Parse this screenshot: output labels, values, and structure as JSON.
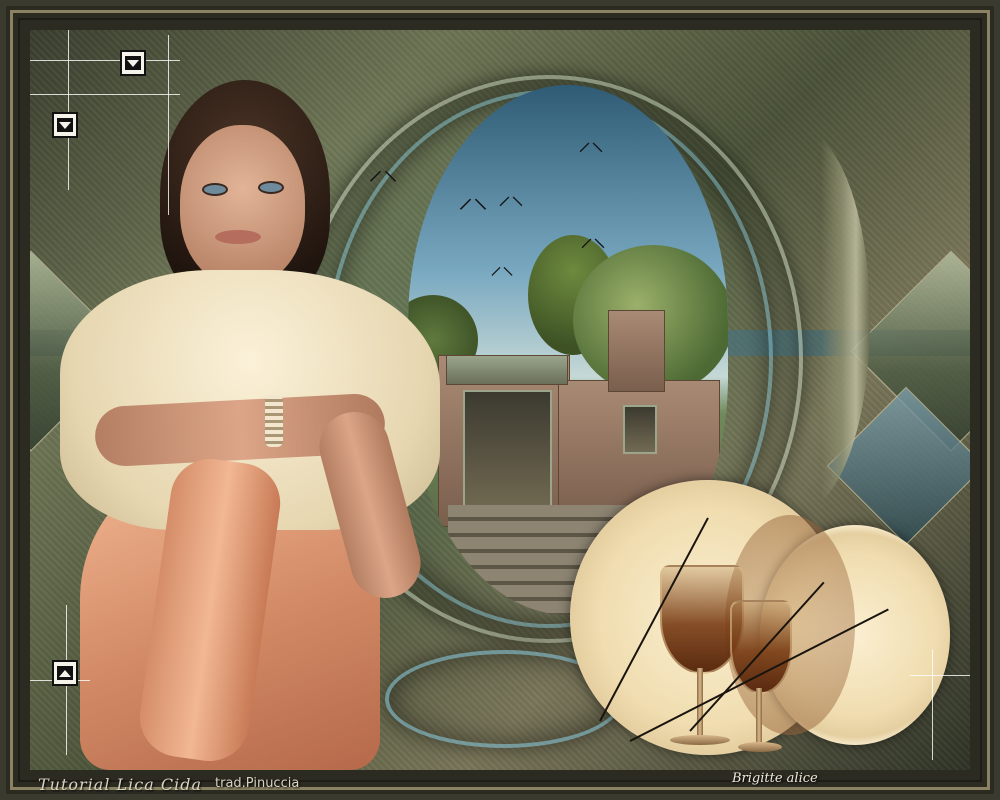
{
  "artwork": {
    "scene": "framed digital collage",
    "colors": {
      "frame": "#3b3a2e",
      "background_olive": "#6d7454",
      "teal_band": "#4b7c8c",
      "sweater_cream": "#fbf1d8",
      "skirt_peach": "#d48d68",
      "plate_cream": "#f0ddb0",
      "wine": "#5a2a10"
    },
    "icons": [
      "bird-icon",
      "chevron-down-icon",
      "chevron-up-icon"
    ]
  },
  "credits": {
    "tutorial": "Tutorial Lica Cida",
    "translator": "trad.Pinuccia",
    "signature": "Brigitte alice"
  }
}
